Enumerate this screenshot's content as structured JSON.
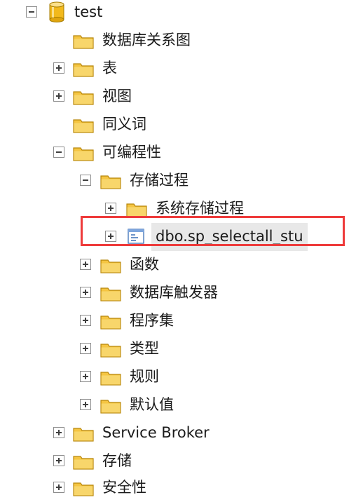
{
  "tree": {
    "root": {
      "label": "test",
      "icon": "database-icon",
      "state": "expanded"
    },
    "items": [
      {
        "label": "数据库关系图",
        "icon": "folder-icon",
        "state": "none"
      },
      {
        "label": "表",
        "icon": "folder-icon",
        "state": "collapsed"
      },
      {
        "label": "视图",
        "icon": "folder-icon",
        "state": "collapsed"
      },
      {
        "label": "同义词",
        "icon": "folder-icon",
        "state": "none"
      },
      {
        "label": "可编程性",
        "icon": "folder-icon",
        "state": "expanded"
      },
      {
        "label": "存储过程",
        "icon": "folder-icon",
        "state": "expanded"
      },
      {
        "label": "系统存储过程",
        "icon": "folder-icon",
        "state": "collapsed"
      },
      {
        "label": "dbo.sp_selectall_stu",
        "icon": "stored-procedure-icon",
        "state": "collapsed",
        "selected": true
      },
      {
        "label": "函数",
        "icon": "folder-icon",
        "state": "collapsed"
      },
      {
        "label": "数据库触发器",
        "icon": "folder-icon",
        "state": "collapsed"
      },
      {
        "label": "程序集",
        "icon": "folder-icon",
        "state": "collapsed"
      },
      {
        "label": "类型",
        "icon": "folder-icon",
        "state": "collapsed"
      },
      {
        "label": "规则",
        "icon": "folder-icon",
        "state": "collapsed"
      },
      {
        "label": "默认值",
        "icon": "folder-icon",
        "state": "collapsed"
      },
      {
        "label": "Service Broker",
        "icon": "folder-icon",
        "state": "collapsed"
      },
      {
        "label": "存储",
        "icon": "folder-icon",
        "state": "collapsed"
      },
      {
        "label": "安全性",
        "icon": "folder-icon",
        "state": "collapsed"
      }
    ]
  },
  "colors": {
    "highlight_border": "#ee3b3b",
    "folder_fill": "#f5c542",
    "selection_background": "#e8e8e8"
  }
}
